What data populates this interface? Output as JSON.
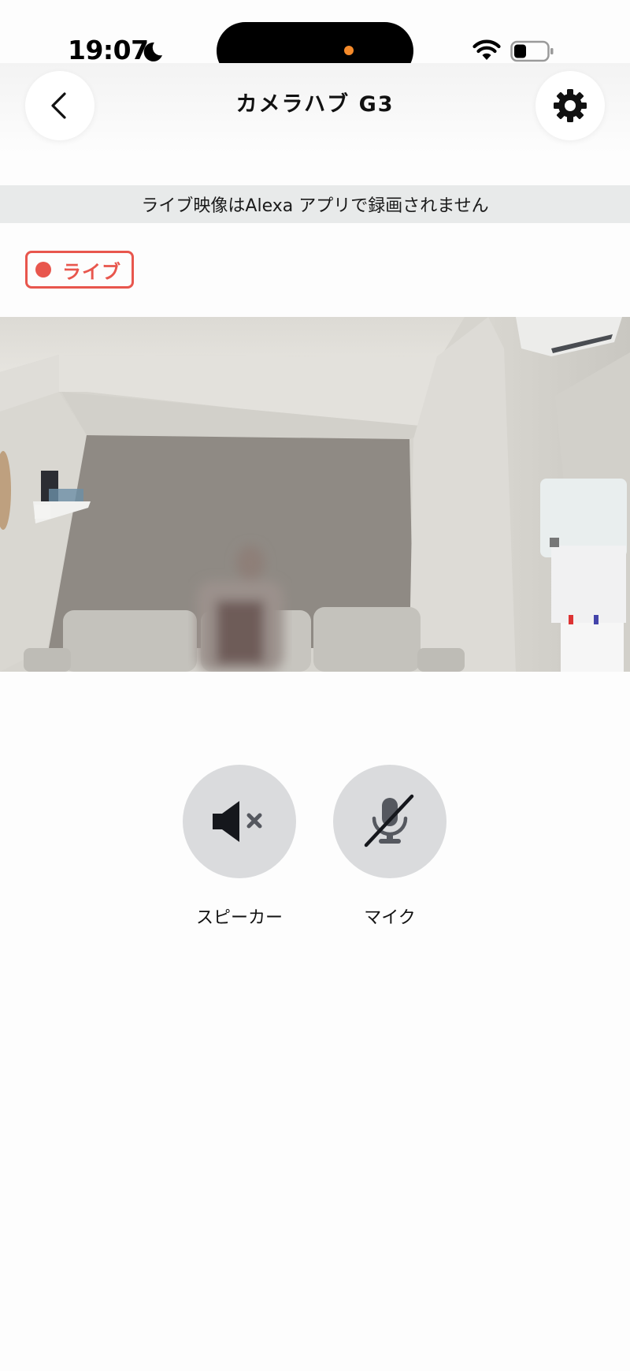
{
  "status_bar": {
    "time": "19:07",
    "icons": [
      "moon-icon",
      "wifi-icon",
      "battery-icon"
    ],
    "privacy_indicator_color": "#f58a2a"
  },
  "header": {
    "title": "カメラハブ G3",
    "left_icon": "chevron-left-icon",
    "right_icon": "gear-icon"
  },
  "banner": {
    "text": "ライブ映像はAlexa アプリで録画されません"
  },
  "live_badge": {
    "label": "ライブ",
    "color": "#e8564d"
  },
  "video": {
    "content": "camera-live-feed"
  },
  "controls": [
    {
      "label": "スピーカー",
      "icon": "speaker-muted-icon"
    },
    {
      "label": "マイク",
      "icon": "mic-muted-icon"
    }
  ]
}
